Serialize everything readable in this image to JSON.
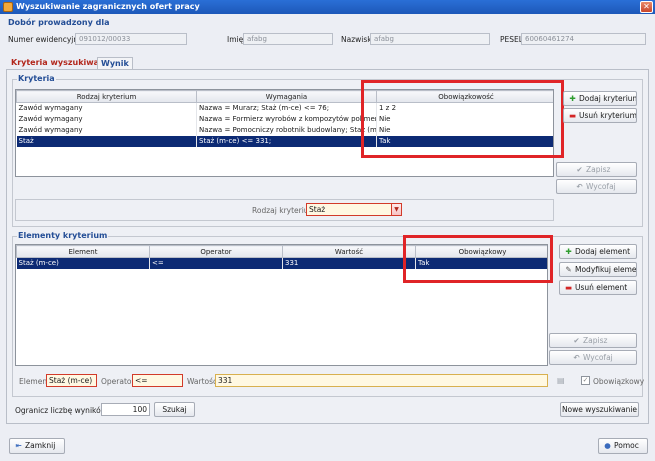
{
  "window": {
    "title": "Wyszukiwanie zagranicznych ofert pracy"
  },
  "header": {
    "section_title": "Dobór prowadzony dla",
    "fields": [
      {
        "label": "Numer ewidencyjny",
        "value": "091012/00033"
      },
      {
        "label": "Imię",
        "value": "afabg"
      },
      {
        "label": "Nazwisko",
        "value": "afabg"
      },
      {
        "label": "PESEL",
        "value": "60060461274"
      }
    ]
  },
  "tabs": [
    {
      "label": "Kryteria wyszukiwania",
      "active": true
    },
    {
      "label": "Wynik",
      "active": false
    }
  ],
  "kryteria": {
    "legend": "Kryteria",
    "columns": [
      "Rodzaj kryterium",
      "Wymagania",
      "Obowiązkowość"
    ],
    "rows": [
      [
        "Zawód wymagany",
        "Nazwa = Murarz; Staż (m-ce) <= 76;",
        "1 z 2"
      ],
      [
        "Zawód wymagany",
        "Nazwa = Formierz wyrobów z kompozytów polimerowych;",
        "Nie"
      ],
      [
        "Zawód wymagany",
        "Nazwa = Pomocniczy robotnik budowlany; Staż (m-ce) <= 12;",
        "Nie"
      ],
      [
        "Staż",
        "Staż (m-ce) <= 331;",
        "Tak"
      ]
    ],
    "selected_row": 3,
    "buttons": {
      "add": "Dodaj kryterium",
      "remove": "Usuń kryterium",
      "save": "Zapisz",
      "revert": "Wycofaj"
    },
    "rodzaj_label": "Rodzaj kryterium",
    "rodzaj_value": "Staż"
  },
  "elementy": {
    "legend": "Elementy kryterium",
    "columns": [
      "Element",
      "Operator",
      "Wartość",
      "Obowiązkowy"
    ],
    "rows": [
      [
        "Staż (m-ce)",
        "<=",
        "331",
        "Tak"
      ]
    ],
    "selected_row": 0,
    "buttons": {
      "add": "Dodaj element",
      "modify": "Modyfikuj element",
      "remove": "Usuń element",
      "save": "Zapisz",
      "revert": "Wycofaj"
    },
    "editor": {
      "element_label": "Element",
      "element_value": "Staż (m-ce)",
      "operator_label": "Operator",
      "operator_value": "<=",
      "wartosc_label": "Wartość",
      "wartosc_value": "331",
      "obowiazkowy_label": "Obowiązkowy",
      "obowiazkowy_checked": true
    }
  },
  "limit": {
    "label": "Ogranicz liczbę wyników do",
    "value": "100",
    "search_button": "Szukaj",
    "new_search_button": "Nowe wyszukiwanie"
  },
  "footer": {
    "close_button": "Zamknij",
    "help_button": "Pomoc"
  },
  "colors": {
    "selection": "#0c2a74",
    "section_title": "#244e96",
    "highlight_box": "#e02427",
    "active_tab": "#b2261b"
  }
}
